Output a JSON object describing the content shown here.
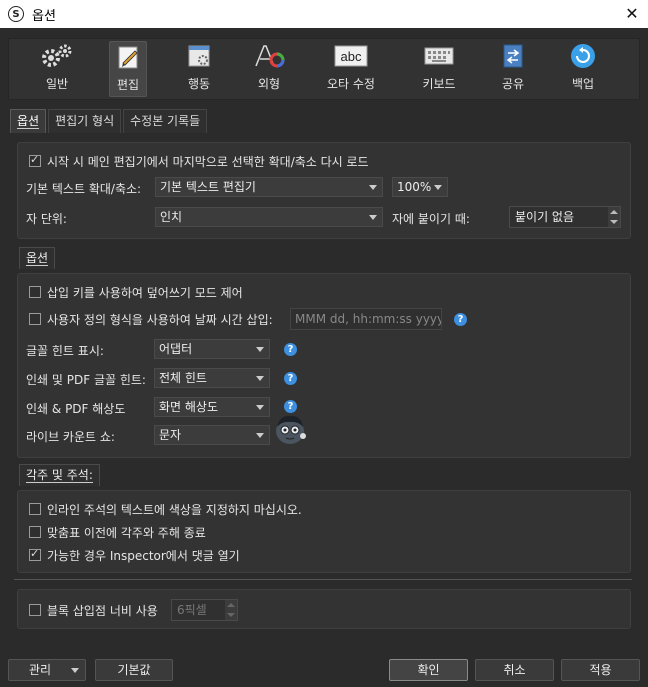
{
  "window": {
    "title": "옵션",
    "app_icon_letter": "S"
  },
  "toolbar": {
    "items": [
      {
        "label": "일반",
        "icon": "gears-icon"
      },
      {
        "label": "편집",
        "icon": "pencil-icon",
        "active": true
      },
      {
        "label": "행동",
        "icon": "window-gear-icon"
      },
      {
        "label": "외형",
        "icon": "font-color-icon"
      },
      {
        "label": "오타 수정",
        "icon": "abc-icon"
      },
      {
        "label": "키보드",
        "icon": "keyboard-icon"
      },
      {
        "label": "공유",
        "icon": "share-icon"
      },
      {
        "label": "백업",
        "icon": "backup-icon"
      }
    ]
  },
  "tabs": [
    {
      "label": "옵션",
      "active": true
    },
    {
      "label": "편집기 형식"
    },
    {
      "label": "수정본 기록들"
    }
  ],
  "section1": {
    "reload_zoom_checkbox": {
      "label": "시작 시 메인 편집기에서 마지막으로 선택한 확대/축소 다시 로드",
      "checked": true
    },
    "default_zoom_label": "기본 텍스트 확대/축소:",
    "default_zoom_editor": "기본 텍스트 편집기",
    "default_zoom_value": "100%",
    "units_label": "자 단위:",
    "units_value": "인치",
    "snap_label": "자에 붙이기 때:",
    "snap_value": "붙이기 없음"
  },
  "options_group": {
    "title": "옵션",
    "overwrite_checkbox": {
      "label": "삽입 키를 사용하여 덮어쓰기 모드 제어",
      "checked": false
    },
    "custom_date_checkbox": {
      "label": "사용자 정의 형식을 사용하여 날짜 시간 삽입:",
      "checked": false
    },
    "custom_date_placeholder": "MMM dd, hh:mm:ss yyyy",
    "font_hint_label": "글꼴 힌트 표시:",
    "font_hint_value": "어댑터",
    "print_hint_label": "인쇄 및 PDF 글꼴 힌트:",
    "print_hint_value": "전체 힌트",
    "print_res_label": "인쇄 & PDF 해상도",
    "print_res_value": "화면 해상도",
    "live_count_label": "라이브 카운트 쇼:",
    "live_count_value": "문자",
    "help_glyph": "?"
  },
  "footnotes_group": {
    "title": "각주 및 주석:",
    "no_color_checkbox": {
      "label": "인라인 주석의 텍스트에 색상을 지정하지 마십시오.",
      "checked": false
    },
    "end_before_punct_checkbox": {
      "label": "맞춤표 이전에 각주와 주해 종료",
      "checked": false
    },
    "open_inspector_checkbox": {
      "label": "가능한 경우 Inspector에서 댓글 열기",
      "checked": true
    }
  },
  "block_insert": {
    "checkbox": {
      "label": "블록 삽입점 너비 사용",
      "checked": false
    },
    "value": "6픽셀"
  },
  "buttons": {
    "manage": "관리",
    "defaults": "기본값",
    "ok": "확인",
    "cancel": "취소",
    "apply": "적용"
  },
  "colors": {
    "background": "#2b2b2b",
    "accent_help": "#3d8fe0"
  }
}
